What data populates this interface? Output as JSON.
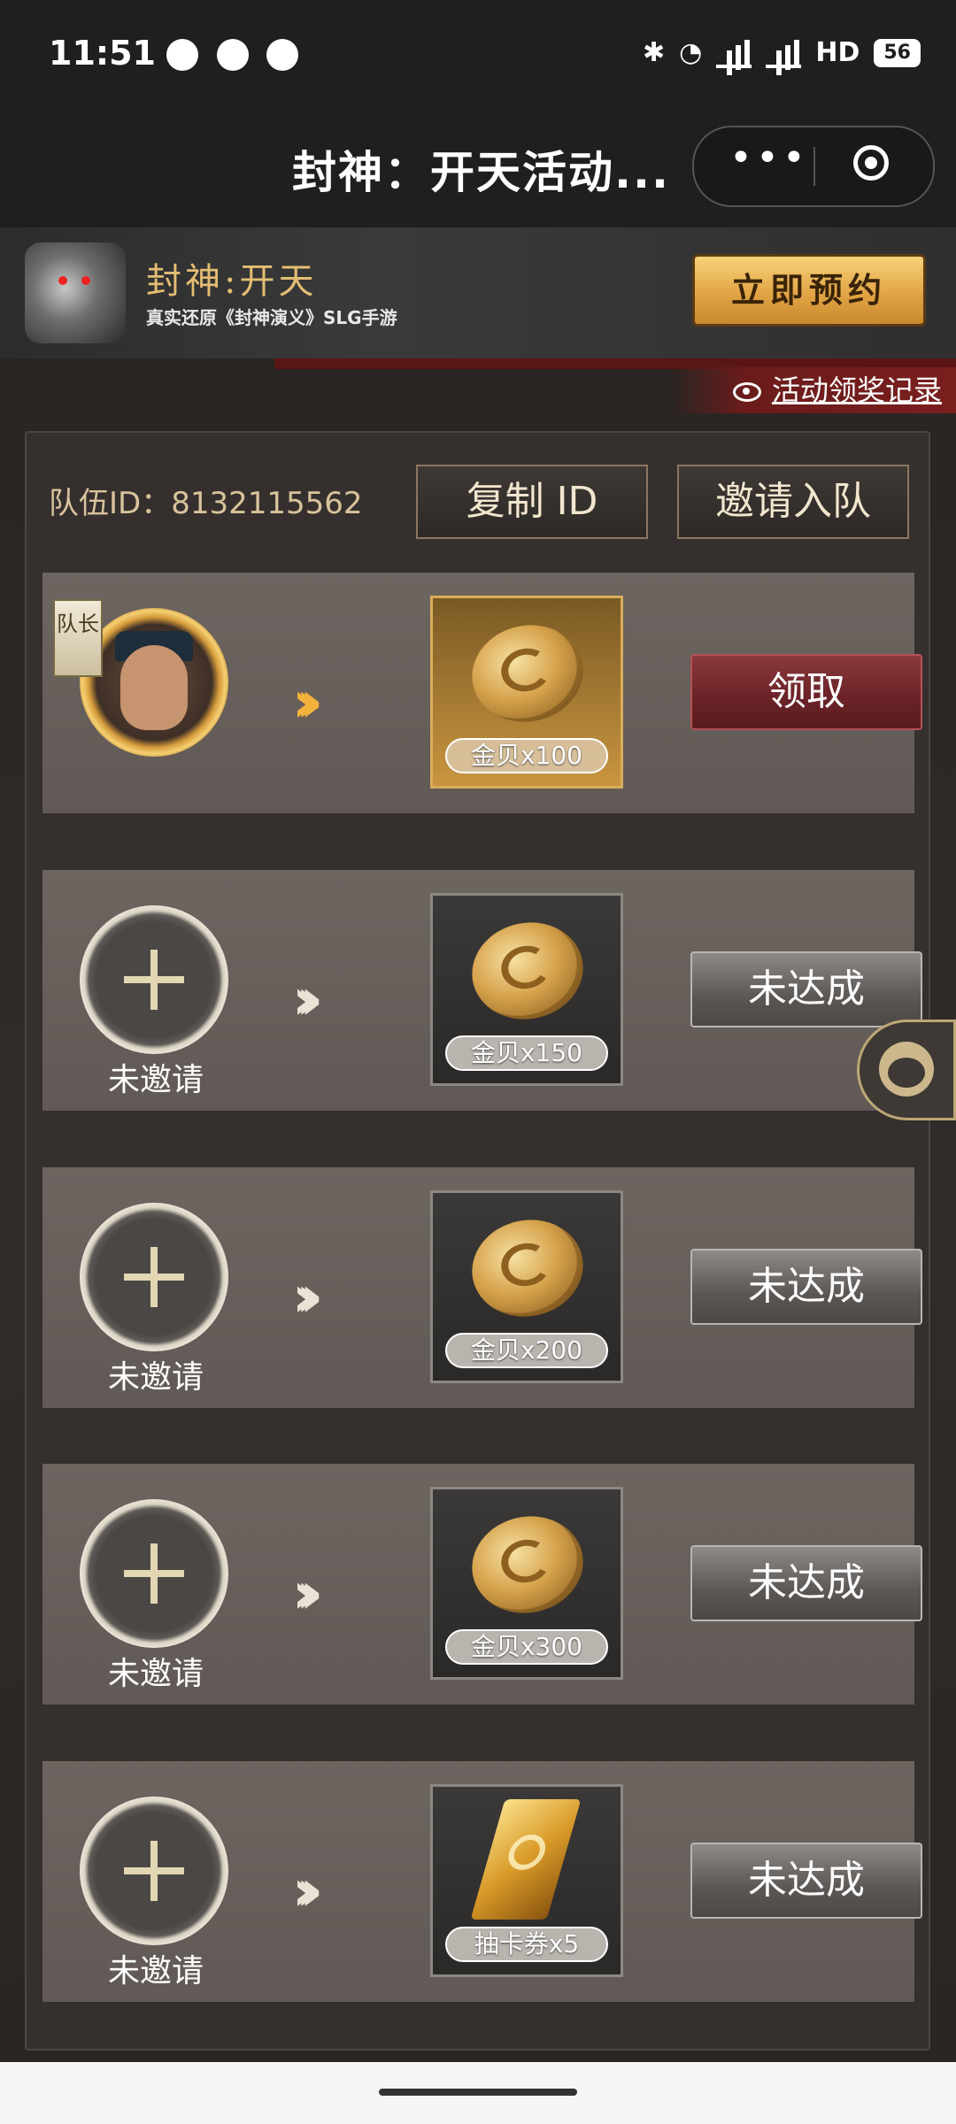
{
  "status_bar": {
    "time": "11:51",
    "network": "5G",
    "hd": "HD",
    "battery": "56"
  },
  "title_bar": {
    "title": "封神：开天活动...",
    "more_icon": "more-icon",
    "close_icon": "target-icon"
  },
  "banner": {
    "game_name": "封神:开天",
    "game_desc": "真实还原《封神演义》SLG手游",
    "reserve_button": "立即预约"
  },
  "record_link": "活动领奖记录",
  "team": {
    "id_label": "队伍ID：8132115562",
    "copy_button": "复制 ID",
    "invite_button": "邀请入队"
  },
  "leader_tag": "队长",
  "rows": [
    {
      "reward": "金贝x100",
      "action": "领取",
      "member_label": ""
    },
    {
      "reward": "金贝x150",
      "action": "未达成",
      "member_label": "未邀请"
    },
    {
      "reward": "金贝x200",
      "action": "未达成",
      "member_label": "未邀请"
    },
    {
      "reward": "金贝x300",
      "action": "未达成",
      "member_label": "未邀请"
    },
    {
      "reward": "抽卡券x5",
      "action": "未达成",
      "member_label": "未邀请"
    }
  ],
  "colors": {
    "accent_gold": "#e3bd72",
    "claim_red": "#6a2226",
    "panel": "#35302e"
  }
}
